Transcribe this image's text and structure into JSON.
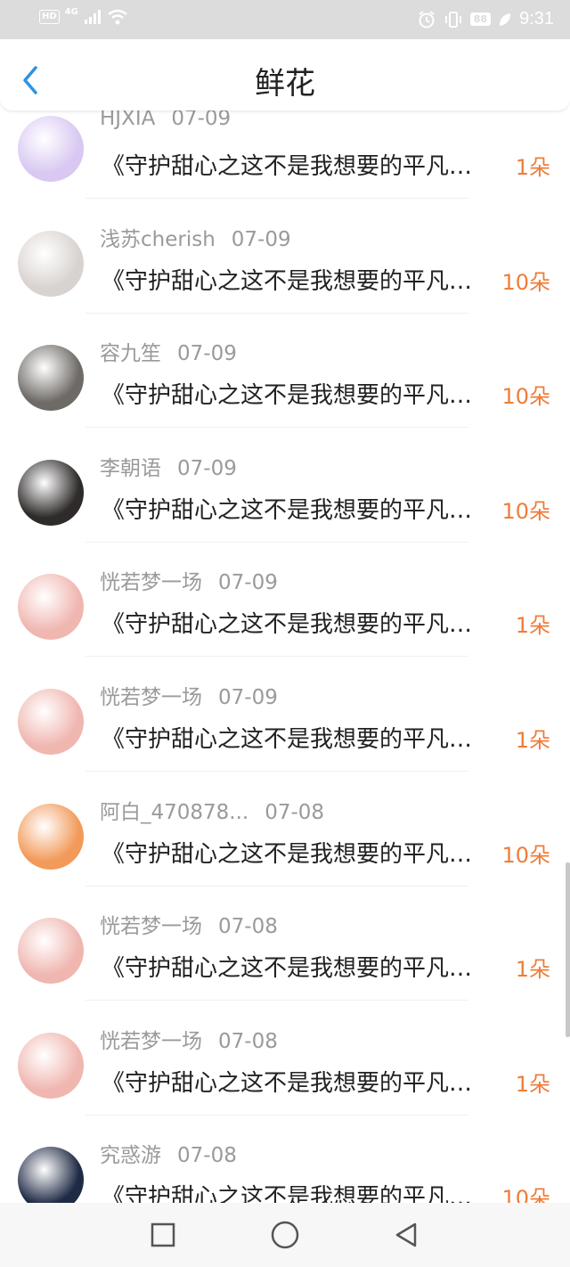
{
  "status_bar": {
    "hd": "HD",
    "network": "4G",
    "battery": "88",
    "time": "9:31"
  },
  "header": {
    "title": "鲜花",
    "back_icon": "chevron-left-icon"
  },
  "rows": [
    {
      "name": "HJXIA",
      "date": "07-09",
      "text": "《守护甜心之这不是我想要的平凡生活》",
      "count": "1朵",
      "avatar_color": "#d8c8f2"
    },
    {
      "name": "浅苏cherish",
      "date": "07-09",
      "text": "《守护甜心之这不是我想要的平凡生活》",
      "count": "10朵",
      "avatar_color": "#d9d3cf"
    },
    {
      "name": "容九笙",
      "date": "07-09",
      "text": "《守护甜心之这不是我想要的平凡生活》",
      "count": "10朵",
      "avatar_color": "#6e6a66"
    },
    {
      "name": "李朝语",
      "date": "07-09",
      "text": "《守护甜心之这不是我想要的平凡生活》",
      "count": "10朵",
      "avatar_color": "#2e2b2a"
    },
    {
      "name": "恍若梦一场",
      "date": "07-09",
      "text": "《守护甜心之这不是我想要的平凡生活》",
      "count": "1朵",
      "avatar_color": "#f0b6b0"
    },
    {
      "name": "恍若梦一场",
      "date": "07-09",
      "text": "《守护甜心之这不是我想要的平凡生活》",
      "count": "1朵",
      "avatar_color": "#f0b6b0"
    },
    {
      "name": "阿白_470878...",
      "date": "07-08",
      "text": "《守护甜心之这不是我想要的平凡生活》",
      "count": "10朵",
      "avatar_color": "#f29a5a"
    },
    {
      "name": "恍若梦一场",
      "date": "07-08",
      "text": "《守护甜心之这不是我想要的平凡生活》",
      "count": "1朵",
      "avatar_color": "#f0b6b0"
    },
    {
      "name": "恍若梦一场",
      "date": "07-08",
      "text": "《守护甜心之这不是我想要的平凡生活》",
      "count": "1朵",
      "avatar_color": "#f0b6b0"
    },
    {
      "name": "究惑游",
      "date": "07-08",
      "text": "《守护甜心之这不是我想要的平凡生活》",
      "count": "10朵",
      "avatar_color": "#1f2a45"
    }
  ],
  "navbar": {
    "recents_icon": "square-icon",
    "home_icon": "circle-icon",
    "back_icon": "triangle-back-icon"
  }
}
